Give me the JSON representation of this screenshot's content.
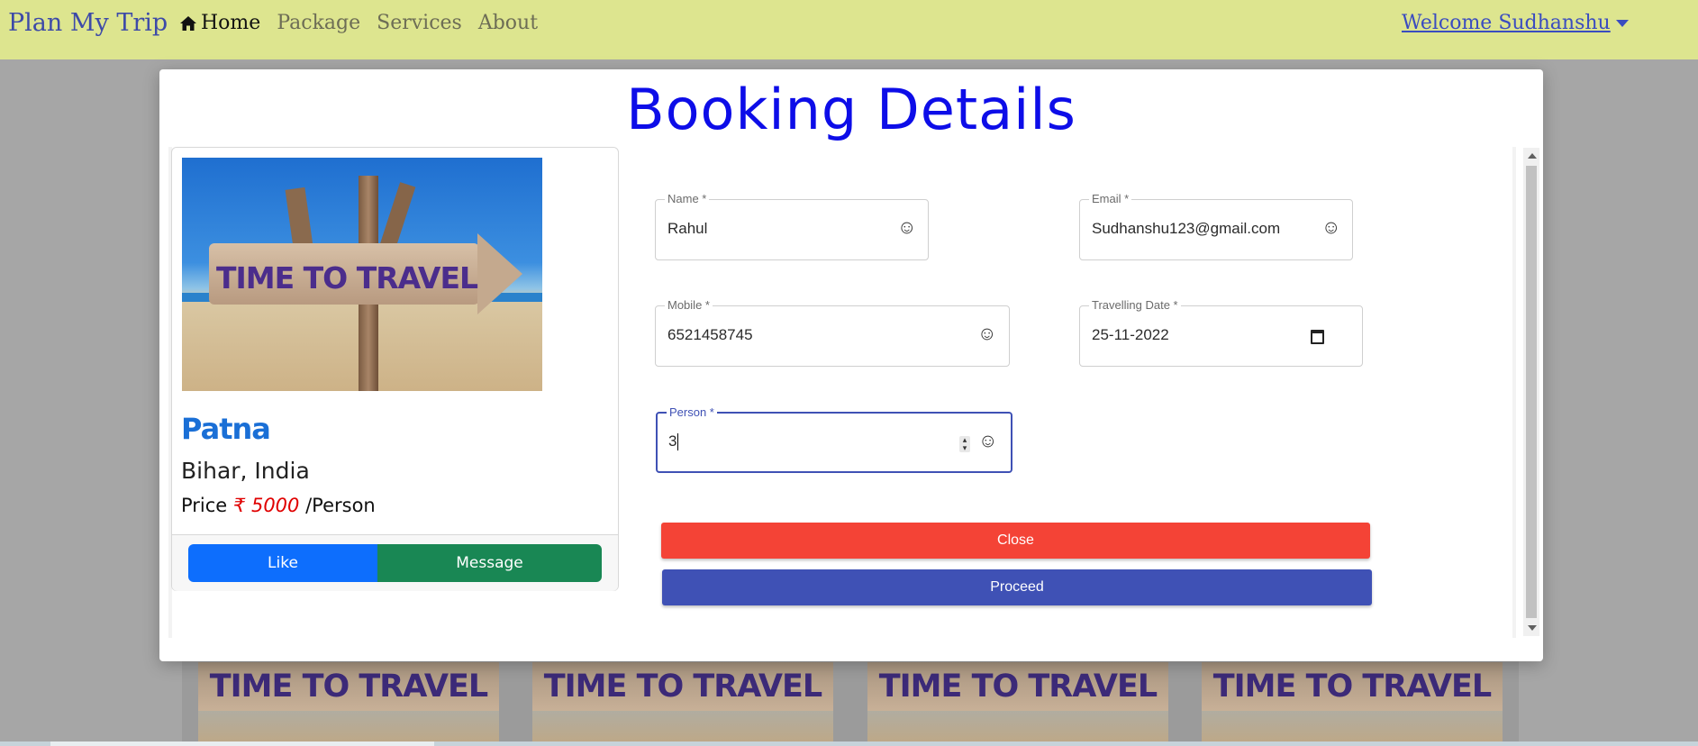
{
  "navbar": {
    "brand": "Plan My Trip",
    "links": [
      {
        "label": "Home",
        "icon": "home-icon",
        "active": true
      },
      {
        "label": "Package"
      },
      {
        "label": "Services"
      },
      {
        "label": "About"
      }
    ],
    "welcome": "Welcome Sudhanshu"
  },
  "modal": {
    "title": "Booking Details",
    "package": {
      "image_text": "TIME TO TRAVEL",
      "city": "Patna",
      "state": "Bihar, India",
      "price_label": "Price",
      "price_amount": "₹ 5000",
      "price_unit": "/Person",
      "like_label": "Like",
      "message_label": "Message"
    },
    "form": {
      "name": {
        "label": "Name *",
        "value": "Rahul"
      },
      "email": {
        "label": "Email *",
        "value": "Sudhanshu123@gmail.com"
      },
      "mobile": {
        "label": "Mobile *",
        "value": "6521458745"
      },
      "date": {
        "label": "Travelling Date *",
        "value": "25-11-2022"
      },
      "person": {
        "label": "Person *",
        "value": "3"
      }
    },
    "close_label": "Close",
    "proceed_label": "Proceed"
  },
  "background_cards": [
    "TIME TO TRAVEL",
    "TIME TO TRAVEL",
    "TIME TO TRAVEL",
    "TIME TO TRAVEL"
  ],
  "colors": {
    "navbar_bg": "#dde58f",
    "title": "#0d0de8",
    "city": "#1a6fd6",
    "price": "#e00000",
    "like": "#0d6efd",
    "message": "#198754",
    "close": "#f44336",
    "proceed": "#3f51b5"
  }
}
